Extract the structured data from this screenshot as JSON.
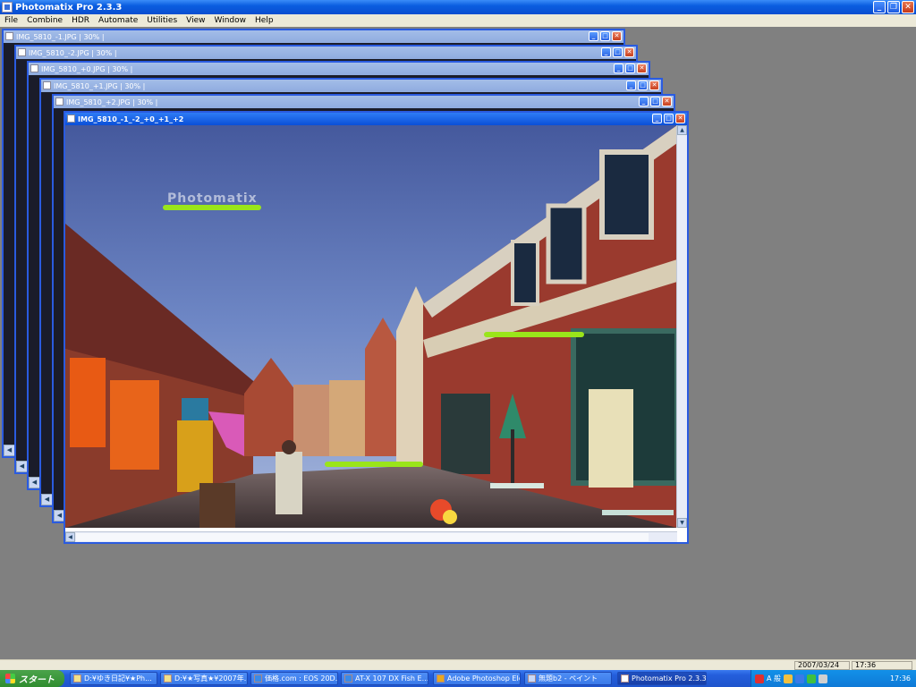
{
  "app": {
    "title": "Photomatix Pro 2.3.3"
  },
  "menu": [
    "File",
    "Combine",
    "HDR",
    "Automate",
    "Utilities",
    "View",
    "Window",
    "Help"
  ],
  "windows": [
    {
      "title": "IMG_5810_-1.JPG | 30% |"
    },
    {
      "title": "IMG_5810_-2.JPG | 30% |"
    },
    {
      "title": "IMG_5810_+0.JPG | 30% |"
    },
    {
      "title": "IMG_5810_+1.JPG | 30% |"
    },
    {
      "title": "IMG_5810_+2.JPG | 30% |"
    }
  ],
  "active_window": {
    "title": "IMG_5810_-1_-2_+0_+1_+2"
  },
  "watermark": "Photomatix",
  "status": {
    "date": "2007/03/24",
    "time": "17:36"
  },
  "taskbar": {
    "start": "スタート",
    "tasks": [
      {
        "label": "D:¥ゆき日記¥★Ph..."
      },
      {
        "label": "D:¥★写真★¥2007年..."
      },
      {
        "label": "価格.com : EOS 20D..."
      },
      {
        "label": "AT-X 107 DX Fish E..."
      },
      {
        "label": "Adobe Photoshop Ele..."
      },
      {
        "label": "無題b2 - ペイント"
      },
      {
        "label": "Photomatix Pro 2.3.3"
      }
    ],
    "tray_text": "A 般",
    "clock": "17:36"
  },
  "colors": {
    "title_active": "#0a4fd8",
    "title_inactive": "#8fabdf",
    "highlight_bar": "#9ae51a",
    "mdi_bg": "#808080"
  }
}
